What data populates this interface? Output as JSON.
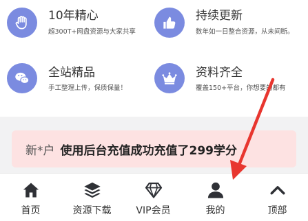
{
  "features": [
    {
      "title": "10年精心",
      "desc": "超300T+网盘资源与大家共享",
      "icon": "hand-icon"
    },
    {
      "title": "持续更新",
      "desc": "数年如一日整合资源，从未间断。",
      "icon": "thumbs-up-icon"
    },
    {
      "title": "全站精品",
      "desc": "手工整理上传，保质保量！",
      "icon": "chat-icon"
    },
    {
      "title": "资料齐全",
      "desc": "覆盖150+平台，你想要的都有",
      "icon": "crown-icon"
    }
  ],
  "notice": {
    "user": "新*户",
    "text": "使用后台充值成功充值了299学分"
  },
  "tabbar": [
    {
      "label": "首页",
      "icon": "home-icon"
    },
    {
      "label": "资源下载",
      "icon": "layers-icon"
    },
    {
      "label": "VIP会员",
      "icon": "diamond-icon"
    },
    {
      "label": "我的",
      "icon": "user-icon"
    },
    {
      "label": "顶部",
      "icon": "chevron-up-icon"
    }
  ],
  "colors": {
    "accent": "#7b8be0",
    "notice_bg": "#fde2e2",
    "arrow": "#e8362f"
  }
}
